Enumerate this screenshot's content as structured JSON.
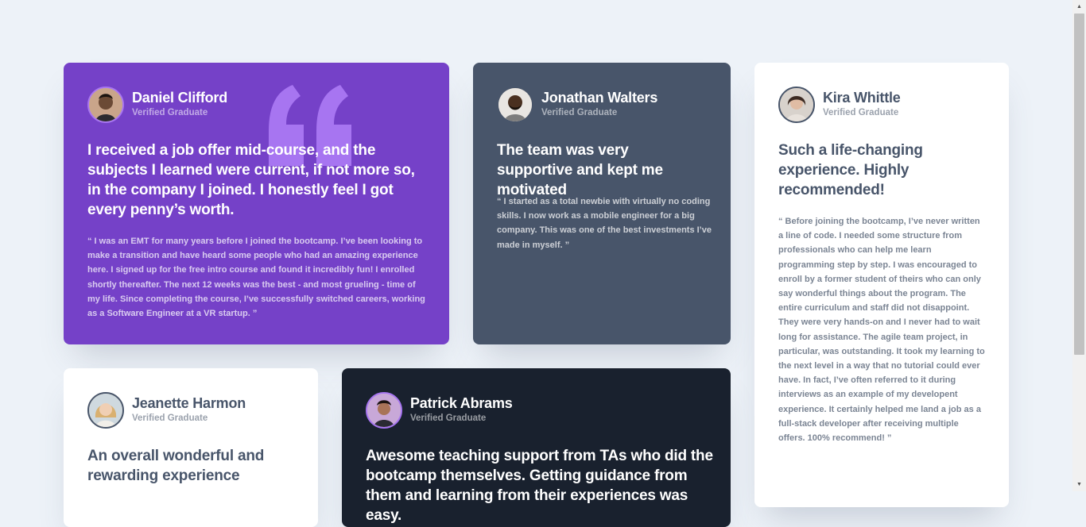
{
  "testimonials": [
    {
      "name": "Daniel Clifford",
      "role": "Verified Graduate",
      "headline": "I received a job offer mid-course, and the subjects I learned were current, if not more so, in the company I joined. I honestly feel I got every penny’s worth.",
      "quote": "“ I was an EMT for many years before I joined the bootcamp. I’ve been looking to make a transition and have heard some people who had an amazing experience here. I signed up for the free intro course and found it incredibly fun! I enrolled shortly thereafter. The next 12 weeks was the best - and most grueling - time of my life. Since completing the course, I’ve successfully switched careers, working as a Software Engineer at a VR startup. ”"
    },
    {
      "name": "Jonathan Walters",
      "role": "Verified Graduate",
      "headline": "The team was very supportive and kept me motivated",
      "quote": "“ I started as a total newbie with virtually no coding skills. I now work as a mobile engineer for a big company. This was one of the best investments I’ve made in myself. ”"
    },
    {
      "name": "Kira Whittle",
      "role": "Verified Graduate",
      "headline": "Such a life-changing experience. Highly recommended!",
      "quote": "“ Before joining the bootcamp, I’ve never written a line of code. I needed some structure from professionals who can help me learn programming step by step. I was encouraged to enroll by a former student of theirs who can only say wonderful things about the program. The entire curriculum and staff did not disappoint. They were very hands-on and I never had to wait long for assistance. The agile team project, in particular, was outstanding. It took my learning to the next level in a way that no tutorial could ever have. In fact, I’ve often referred to it during interviews as an example of my developent experience. It certainly helped me land a job as a full-stack developer after receiving multiple offers. 100% recommend! ”"
    },
    {
      "name": "Jeanette Harmon",
      "role": "Verified Graduate",
      "headline": "An overall wonderful and rewarding experience",
      "quote": ""
    },
    {
      "name": "Patrick Abrams",
      "role": "Verified Graduate",
      "headline": "Awesome teaching support from TAs who did the bootcamp themselves. Getting guidance from them and learning from their experiences was easy.",
      "quote": ""
    }
  ],
  "colors": {
    "purple": "#7541c8",
    "slate": "#48556a",
    "dark": "#19212e",
    "white": "#ffffff",
    "background": "#edf2f8",
    "accent": "#a775f1"
  },
  "icons": [
    "quotation-mark-icon",
    "avatar"
  ]
}
